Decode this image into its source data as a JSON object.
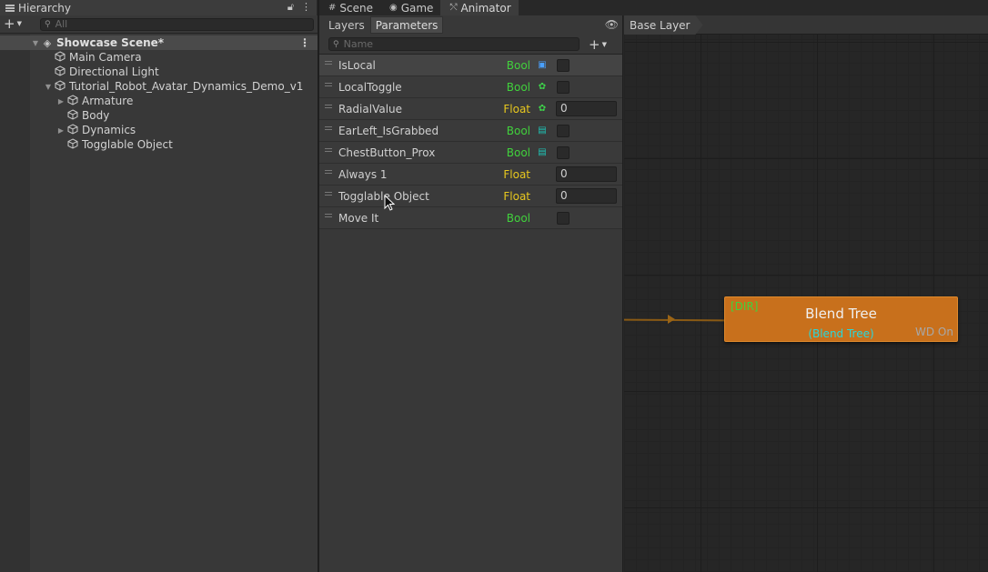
{
  "hierarchy": {
    "tab_label": "Hierarchy",
    "search_placeholder": "All",
    "scene_name": "Showcase Scene*",
    "items": [
      {
        "label": "Main Camera",
        "depth": 1,
        "arrow": ""
      },
      {
        "label": "Directional Light",
        "depth": 1,
        "arrow": ""
      },
      {
        "label": "Tutorial_Robot_Avatar_Dynamics_Demo_v1",
        "depth": 1,
        "arrow": "▼"
      },
      {
        "label": "Armature",
        "depth": 2,
        "arrow": "▶"
      },
      {
        "label": "Body",
        "depth": 2,
        "arrow": ""
      },
      {
        "label": "Dynamics",
        "depth": 2,
        "arrow": "▶"
      },
      {
        "label": "Togglable Object",
        "depth": 2,
        "arrow": ""
      }
    ]
  },
  "window_tabs": {
    "scene": "Scene",
    "game": "Game",
    "animator": "Animator"
  },
  "params_panel": {
    "tab_layers": "Layers",
    "tab_parameters": "Parameters",
    "search_placeholder": "Name",
    "parameters": [
      {
        "name": "IsLocal",
        "type": "Bool",
        "badge": "blue",
        "value": ""
      },
      {
        "name": "LocalToggle",
        "type": "Bool",
        "badge": "green",
        "value": ""
      },
      {
        "name": "RadialValue",
        "type": "Float",
        "badge": "green",
        "value": "0"
      },
      {
        "name": "EarLeft_IsGrabbed",
        "type": "Bool",
        "badge": "teal",
        "value": ""
      },
      {
        "name": "ChestButton_Prox",
        "type": "Bool",
        "badge": "teal",
        "value": ""
      },
      {
        "name": "Always 1",
        "type": "Float",
        "badge": "",
        "value": "0"
      },
      {
        "name": "Togglable Object",
        "type": "Float",
        "badge": "",
        "value": "0"
      },
      {
        "name": "Move It",
        "type": "Bool",
        "badge": "",
        "value": ""
      }
    ]
  },
  "graph": {
    "breadcrumb": "Base Layer",
    "node": {
      "tag": "[DIR]",
      "title": "Blend Tree",
      "subtitle": "(Blend Tree)",
      "wd": "WD On"
    }
  },
  "colors": {
    "bool_type": "#41d23c",
    "float_type": "#e8c81e",
    "node_orange": "#c8701c",
    "subtitle_cyan": "#28d8dc"
  }
}
